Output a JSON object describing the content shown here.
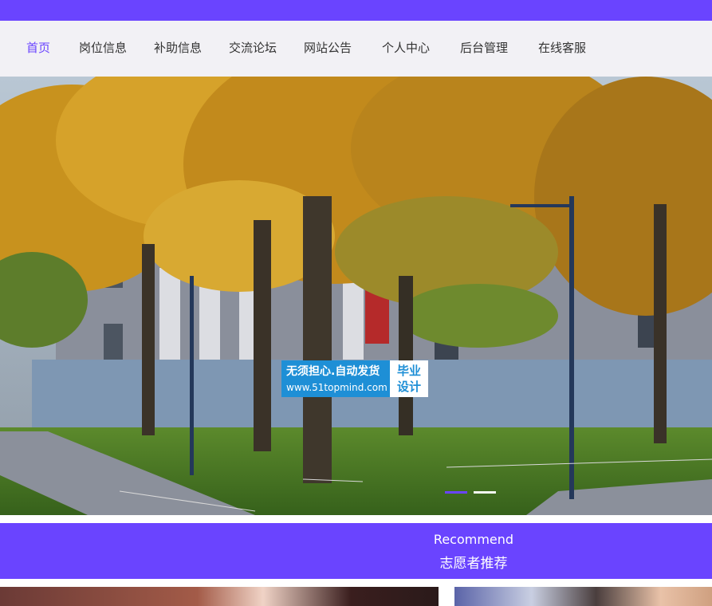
{
  "nav": {
    "items": [
      {
        "label": "首页",
        "active": true
      },
      {
        "label": "岗位信息",
        "active": false
      },
      {
        "label": "补助信息",
        "active": false
      },
      {
        "label": "交流论坛",
        "active": false
      },
      {
        "label": "网站公告",
        "active": false
      },
      {
        "label": "个人中心",
        "active": false
      },
      {
        "label": "后台管理",
        "active": false
      },
      {
        "label": "在线客服",
        "active": false
      }
    ]
  },
  "banner": {
    "watermark": {
      "line1": "无须担心.自动发货",
      "line2": "www.51topmind.com",
      "badge_top": "毕业",
      "badge_bottom": "设计"
    },
    "slides_count": 2,
    "active_slide": 1
  },
  "recommend": {
    "title_en": "Recommend",
    "title_zh": "志愿者推荐"
  },
  "colors": {
    "accent": "#6a44ff",
    "nav_bg": "#f2f1f5",
    "nav_text": "#333333",
    "watermark_blue": "#1e8fd6"
  }
}
